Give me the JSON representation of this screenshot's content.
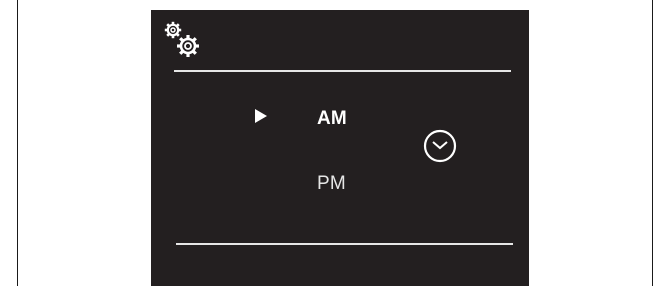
{
  "device": {
    "screen_background": "#231f20",
    "foreground": "#ffffff"
  },
  "header": {
    "icon": "settings-gears-icon"
  },
  "menu": {
    "selection_indicator": "play-pointer-icon",
    "options": [
      {
        "label": "AM",
        "selected": true
      },
      {
        "label": "PM",
        "selected": false
      }
    ],
    "side_icon": "clock-icon"
  }
}
